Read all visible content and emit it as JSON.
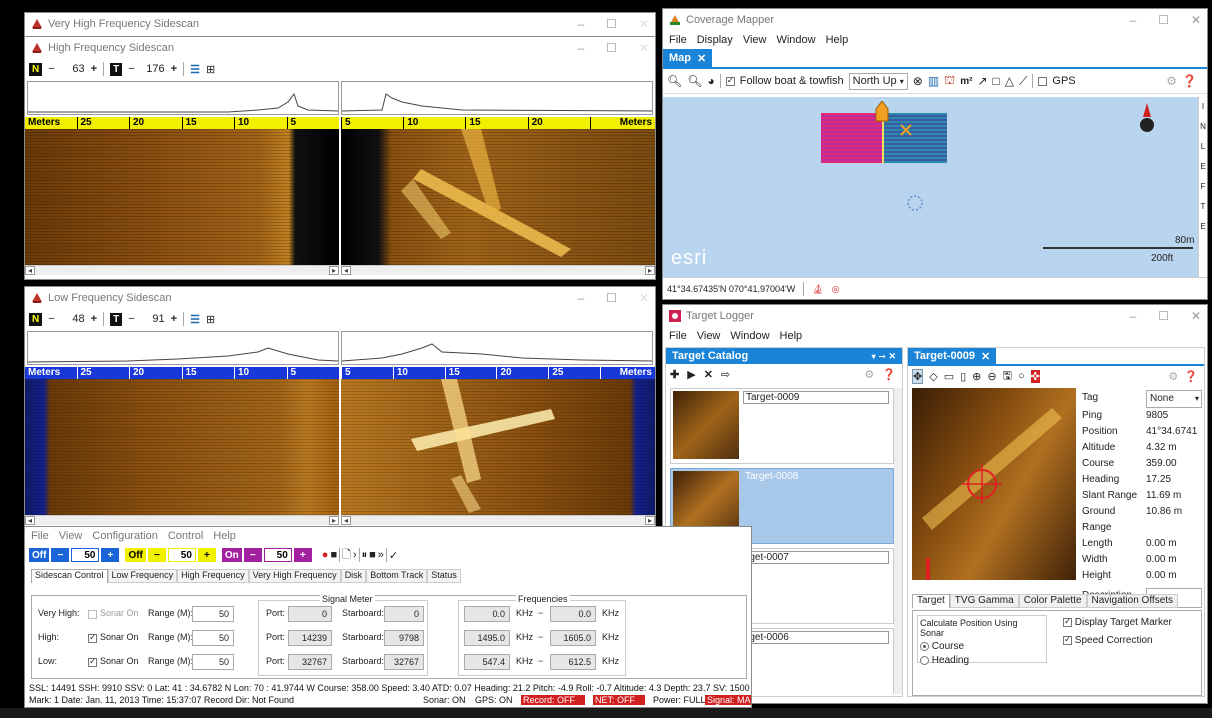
{
  "colors": {
    "accent_blue": "#1a84d8",
    "ruler_yellow": "#f0f000",
    "ruler_blue": "#1838d8",
    "record_red": "#d02020"
  },
  "vhf_window": {
    "title": "Very High Frequency Sidescan"
  },
  "hf_window": {
    "title": "High Frequency Sidescan",
    "toolbar": {
      "n_label": "N",
      "n_minus": "−",
      "n_value": "63",
      "n_plus": "+",
      "t_label": "T",
      "t_minus": "−",
      "t_value": "176",
      "t_plus": "+"
    },
    "ruler_left": [
      "Meters",
      "25",
      "20",
      "15",
      "10",
      "5"
    ],
    "ruler_right": [
      "5",
      "10",
      "15",
      "20",
      "Meters"
    ]
  },
  "lf_window": {
    "title": "Low Frequency Sidescan",
    "toolbar": {
      "n_label": "N",
      "n_minus": "−",
      "n_value": "48",
      "n_plus": "+",
      "t_label": "T",
      "t_minus": "−",
      "t_value": "91",
      "t_plus": "+"
    },
    "ruler_left": [
      "Meters",
      "25",
      "20",
      "15",
      "10",
      "5"
    ],
    "ruler_right": [
      "5",
      "10",
      "15",
      "20",
      "25",
      "Meters"
    ]
  },
  "coverage_mapper": {
    "title": "Coverage Mapper",
    "menu": [
      "File",
      "Display",
      "View",
      "Window",
      "Help"
    ],
    "tab": "Map",
    "follow_label": "Follow boat & towfish",
    "orientation": "North Up",
    "gps_label": "GPS",
    "scale_m": "80m",
    "scale_ft": "200ft",
    "esri": "esri",
    "coords": "41°34.67435'N 070°41.97004'W",
    "side_letters": [
      "I",
      "N",
      "L",
      "E",
      "F",
      "T",
      "E"
    ]
  },
  "target_logger": {
    "title": "Target Logger",
    "menu": [
      "File",
      "View",
      "Window",
      "Help"
    ],
    "catalog_tab": "Target Catalog",
    "detail_tab": "Target-0009",
    "targets": [
      "Target-0009",
      "Target-0008",
      "rget-0007",
      "rget-0006"
    ],
    "fields": [
      {
        "k": "Tag",
        "v": "None"
      },
      {
        "k": "Ping",
        "v": "9805"
      },
      {
        "k": "Position",
        "v": "41°34.6741"
      },
      {
        "k": "Altitude",
        "v": "4.32 m"
      },
      {
        "k": "Course",
        "v": "359.00"
      },
      {
        "k": "Heading",
        "v": "17.25"
      },
      {
        "k": "Slant Range",
        "v": "11.69 m"
      },
      {
        "k": "Ground Range",
        "v": "10.86 m"
      },
      {
        "k": "Length",
        "v": "0.00 m"
      },
      {
        "k": "Width",
        "v": "0.00 m"
      },
      {
        "k": "Height",
        "v": "0.00 m"
      }
    ],
    "description_label": "Description",
    "subtabs": [
      "Target",
      "TVG Gamma",
      "Color Palette",
      "Navigation Offsets"
    ],
    "calc_label": "Calculate Position Using Sonar",
    "radio_course": "Course",
    "radio_heading": "Heading",
    "chk_display": "Display Target Marker",
    "chk_speed": "Speed Correction"
  },
  "control_window": {
    "menu": [
      "File",
      "View",
      "Configuration",
      "Control",
      "Help"
    ],
    "buttons": {
      "off1": "Off",
      "minus1": "−",
      "val1": "50",
      "plus1": "+",
      "off2": "Off",
      "minus2": "−",
      "val2": "50",
      "plus2": "+",
      "on3": "On",
      "minus3": "−",
      "val3": "50",
      "plus3": "+"
    },
    "tabs": [
      "Sidescan Control",
      "Low Frequency",
      "High Frequency",
      "Very High Frequency",
      "Disk",
      "Bottom Track",
      "Status"
    ],
    "signal_meter": "Signal Meter",
    "frequencies": "Frequencies",
    "rows": [
      {
        "name": "Very High:",
        "sonar": "Sonar On",
        "sonar_on": false,
        "range_label": "Range (M):",
        "range": "50",
        "port_label": "Port:",
        "port": "0",
        "stbd_label": "Starboard:",
        "stbd": "0",
        "f1": "0.0",
        "f2": "0.0"
      },
      {
        "name": "High:",
        "sonar": "Sonar On",
        "sonar_on": true,
        "range_label": "Range (M):",
        "range": "50",
        "port_label": "Port:",
        "port": "14239",
        "stbd_label": "Starboard:",
        "stbd": "9798",
        "f1": "1495.0",
        "f2": "1605.0"
      },
      {
        "name": "Low:",
        "sonar": "Sonar On",
        "sonar_on": true,
        "range_label": "Range (M):",
        "range": "50",
        "port_label": "Port:",
        "port": "32767",
        "stbd_label": "Starboard:",
        "stbd": "32767",
        "f1": "547.4",
        "f2": "612.5"
      }
    ],
    "khz": "KHz",
    "dash": "−",
    "status_line1": "SSL: 14491  SSH: 9910 SSV: 0   Lat:  41 : 34.6782 N   Lon:  70 : 41.9744 W   Course: 358.00   Speed: 3.40   ATD: 0.07   Heading: 21.2   Pitch:  -4.9   Roll:  -0.7   Altitude:  4.3   Depth:  23.7      SV: 1500",
    "status_line2": "Mark:    1   Date: Jan. 11, 2013   Time: 15:37:07      Record Dir: Not Found",
    "sonar_status": "Sonar: ON",
    "gps_status": "GPS: ON",
    "record_status": "Record: OFF",
    "net_status": "NET: OFF",
    "power_status": "Power: FULL",
    "signal_status": "Signal: MAX"
  }
}
